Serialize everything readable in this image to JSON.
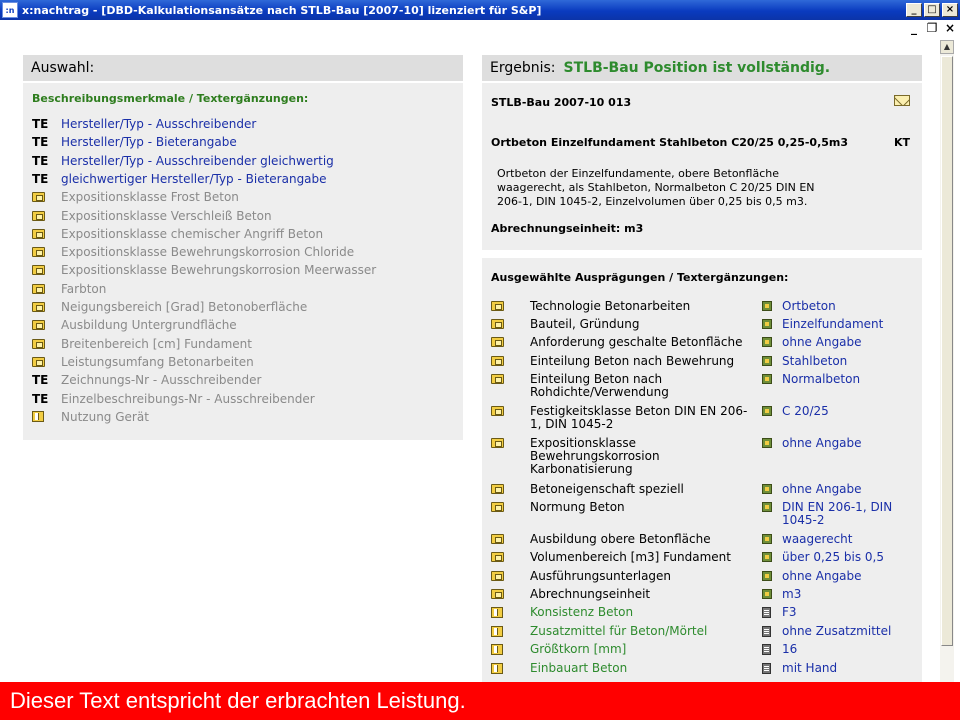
{
  "window": {
    "app_icon": ":n",
    "title": "x:nachtrag - [DBD-Kalkulationsansätze nach STLB-Bau [2007-10] lizenziert für S&P]",
    "buttons": [
      "_",
      "□",
      "×"
    ],
    "mdi_buttons": [
      "_",
      "❐",
      "×"
    ]
  },
  "left": {
    "header": "Auswahl:",
    "subheading": "Beschreibungsmerkmale / Textergänzungen:",
    "items": [
      {
        "marker": "TE",
        "icon": "te-text",
        "label": "Hersteller/Typ - Ausschreibender",
        "style": "blue"
      },
      {
        "marker": "TE",
        "icon": "te-text",
        "label": "Hersteller/Typ - Bieterangabe",
        "style": "blue"
      },
      {
        "marker": "TE",
        "icon": "te-text",
        "label": "Hersteller/Typ - Ausschreibender gleichwertig",
        "style": "blue"
      },
      {
        "marker": "TE",
        "icon": "te-text",
        "label": "gleichwertiger Hersteller/Typ - Bieterangabe",
        "style": "blue"
      },
      {
        "marker": "",
        "icon": "folder-icon",
        "label": "Expositionsklasse Frost Beton",
        "style": "grey"
      },
      {
        "marker": "",
        "icon": "folder-icon",
        "label": "Expositionsklasse Verschleiß Beton",
        "style": "grey"
      },
      {
        "marker": "",
        "icon": "folder-icon",
        "label": "Expositionsklasse chemischer Angriff Beton",
        "style": "grey"
      },
      {
        "marker": "",
        "icon": "folder-icon",
        "label": "Expositionsklasse Bewehrungskorrosion Chloride",
        "style": "grey"
      },
      {
        "marker": "",
        "icon": "folder-icon",
        "label": "Expositionsklasse Bewehrungskorrosion Meerwasser",
        "style": "grey"
      },
      {
        "marker": "",
        "icon": "folder-icon",
        "label": "Farbton",
        "style": "grey"
      },
      {
        "marker": "",
        "icon": "folder-icon",
        "label": "Neigungsbereich [Grad] Betonoberfläche",
        "style": "grey"
      },
      {
        "marker": "",
        "icon": "folder-icon",
        "label": "Ausbildung Untergrundfläche",
        "style": "grey"
      },
      {
        "marker": "",
        "icon": "folder-icon",
        "label": "Breitenbereich [cm] Fundament",
        "style": "grey"
      },
      {
        "marker": "",
        "icon": "folder-icon",
        "label": "Leistungsumfang Betonarbeiten",
        "style": "grey"
      },
      {
        "marker": "TE",
        "icon": "te-text",
        "label": "Zeichnungs-Nr - Ausschreibender",
        "style": "grey"
      },
      {
        "marker": "TE",
        "icon": "te-text",
        "label": "Einzelbeschreibungs-Nr - Ausschreibender",
        "style": "grey"
      },
      {
        "marker": "",
        "icon": "book-icon",
        "label": "Nutzung Gerät",
        "style": "grey"
      }
    ]
  },
  "right": {
    "header_label": "Ergebnis:",
    "header_status": "STLB-Bau Position ist vollständig.",
    "position_code": "STLB-Bau 2007-10 013",
    "position_title": "Ortbeton Einzelfundament Stahlbeton C20/25 0,25-0,5m3",
    "position_unit_code": "KT",
    "description": "Ortbeton der Einzelfundamente, obere Betonfläche waagerecht, als Stahlbeton, Normalbeton C 20/25 DIN EN 206-1, DIN 1045-2, Einzelvolumen über 0,25 bis 0,5 m3.",
    "billing_unit": "Abrechnungseinheit: m3"
  },
  "features": {
    "heading": "Ausgewählte Ausprägungen / Textergänzungen:",
    "rows": [
      {
        "name": "Technologie Betonarbeiten",
        "value": "Ortbeton",
        "name_style": "black",
        "kind": "folder"
      },
      {
        "name": "Bauteil, Gründung",
        "value": "Einzelfundament",
        "name_style": "black",
        "kind": "folder"
      },
      {
        "name": "Anforderung geschalte Betonfläche",
        "value": "ohne Angabe",
        "name_style": "black",
        "kind": "folder"
      },
      {
        "name": "Einteilung Beton nach Bewehrung",
        "value": "Stahlbeton",
        "name_style": "black",
        "kind": "folder"
      },
      {
        "name": "Einteilung Beton nach Rohdichte/Verwendung",
        "value": "Normalbeton",
        "name_style": "black",
        "kind": "folder"
      },
      {
        "name": "Festigkeitsklasse Beton DIN EN 206-1, DIN 1045-2",
        "value": "C 20/25",
        "name_style": "black",
        "kind": "folder"
      },
      {
        "name": "Expositionsklasse Bewehrungskorrosion Karbonatisierung",
        "value": "ohne Angabe",
        "name_style": "black",
        "kind": "folder"
      },
      {
        "name": "Betoneigenschaft speziell",
        "value": "ohne Angabe",
        "name_style": "black",
        "kind": "folder"
      },
      {
        "name": "Normung Beton",
        "value": "DIN EN 206-1, DIN 1045-2",
        "name_style": "black",
        "kind": "folder"
      },
      {
        "name": "Ausbildung obere Betonfläche",
        "value": "waagerecht",
        "name_style": "black",
        "kind": "folder"
      },
      {
        "name": "Volumenbereich [m3] Fundament",
        "value": "über 0,25 bis 0,5",
        "name_style": "black",
        "kind": "folder"
      },
      {
        "name": "Ausführungsunterlagen",
        "value": "ohne Angabe",
        "name_style": "black",
        "kind": "folder"
      },
      {
        "name": "Abrechnungseinheit",
        "value": "m3",
        "name_style": "black",
        "kind": "folder"
      },
      {
        "name": "Konsistenz Beton",
        "value": "F3",
        "name_style": "green",
        "kind": "book"
      },
      {
        "name": "Zusatzmittel für Beton/Mörtel",
        "value": "ohne Zusatzmittel",
        "name_style": "green",
        "kind": "book"
      },
      {
        "name": "Größtkorn [mm]",
        "value": "16",
        "name_style": "green",
        "kind": "book"
      },
      {
        "name": "Einbauart Beton",
        "value": "mit Hand",
        "name_style": "green",
        "kind": "book"
      }
    ]
  },
  "banner": {
    "text": "Dieser Text entspricht der erbrachten Leistung.",
    "color": "#ff0000"
  }
}
